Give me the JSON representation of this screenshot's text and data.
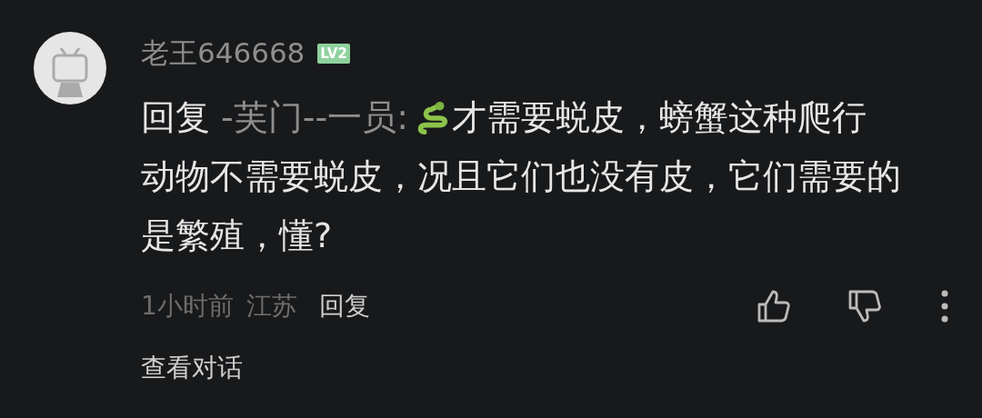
{
  "comment": {
    "username": "老王646668",
    "level_badge": "LV2",
    "reply_label": "回复",
    "mention": "-芙门--一员:",
    "body_lines": [
      "才需要蜕皮，螃蟹这种爬行",
      "动物不需要蜕皮，况且它们也没有皮，它们需要的",
      "是繁殖，懂?"
    ],
    "time": "1小时前",
    "location": "江苏",
    "reply_button": "回复",
    "view_conversation": "查看对话"
  }
}
